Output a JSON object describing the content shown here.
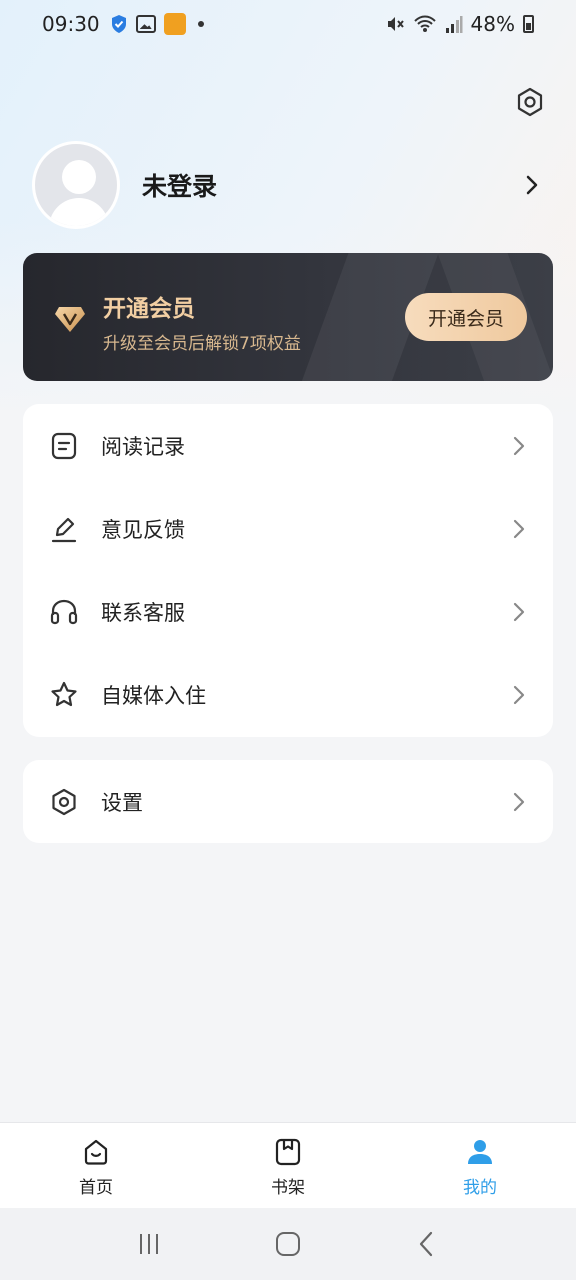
{
  "status_bar": {
    "time": "09:30",
    "battery": "48%",
    "icons": [
      "shield-icon",
      "gallery-icon",
      "app-notification-icon",
      "dot-icon",
      "mute-icon",
      "wifi-icon",
      "signal-icon",
      "battery-icon"
    ]
  },
  "profile": {
    "name": "未登录",
    "avatar_icon": "default-avatar-icon",
    "chevron_icon": "chevron-right-icon"
  },
  "vip": {
    "title": "开通会员",
    "subtitle": "升级至会员后解锁7项权益",
    "button_label": "开通会员",
    "icon": "vip-diamond-icon"
  },
  "menu": {
    "items": [
      {
        "label": "阅读记录",
        "icon": "reading-history-icon"
      },
      {
        "label": "意见反馈",
        "icon": "pencil-icon"
      },
      {
        "label": "联系客服",
        "icon": "headphones-icon"
      },
      {
        "label": "自媒体入住",
        "icon": "star-icon"
      }
    ]
  },
  "settings": {
    "label": "设置",
    "icon": "settings-hexagon-icon"
  },
  "bottom_nav": {
    "items": [
      {
        "label": "首页",
        "icon": "home-icon",
        "active": false
      },
      {
        "label": "书架",
        "icon": "bookshelf-icon",
        "active": false
      },
      {
        "label": "我的",
        "icon": "user-icon",
        "active": true
      }
    ],
    "active_color": "#2f9ee8"
  },
  "colors": {
    "vip_gold": "#f2cfa3",
    "vip_card_bg": "#26272d",
    "accent": "#2f9ee8"
  }
}
